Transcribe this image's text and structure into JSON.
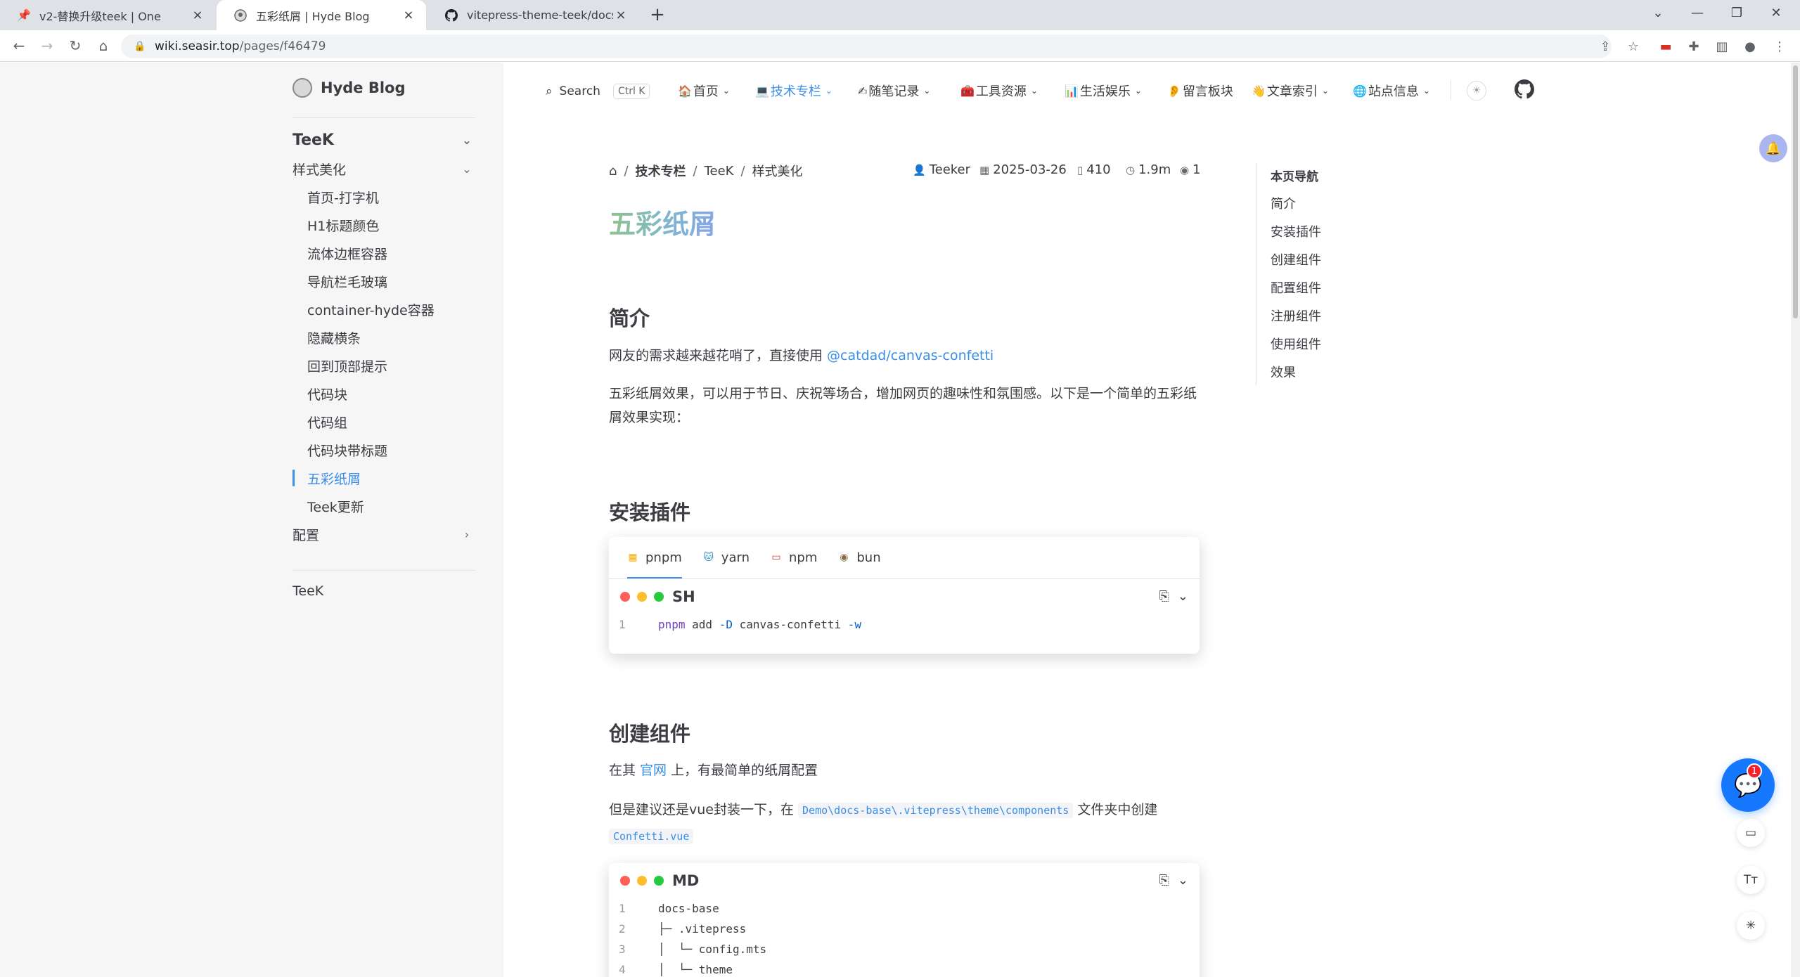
{
  "browser": {
    "tabs": [
      {
        "title": "v2-替换升级teek | One",
        "favicon": "pin-icon"
      },
      {
        "title": "五彩纸屑 | Hyde Blog",
        "favicon": "hyde-icon",
        "active": true
      },
      {
        "title": "vitepress-theme-teek/docs at",
        "favicon": "github-icon"
      }
    ],
    "url_host": "wiki.seasir.top",
    "url_path": "/pages/f46479"
  },
  "sidebar": {
    "brand": "Hyde Blog",
    "group_title": "TeeK",
    "subgroup_title": "样式美化",
    "items": [
      "首页-打字机",
      "H1标题颜色",
      "流体边框容器",
      "导航栏毛玻璃",
      "container-hyde容器",
      "隐藏横条",
      "回到顶部提示",
      "代码块",
      "代码组",
      "代码块带标题",
      "五彩纸屑",
      "Teek更新"
    ],
    "active_item": "五彩纸屑",
    "config_group": "配置",
    "bottom_link": "TeeK"
  },
  "nav": {
    "search_label": "Search",
    "search_kbd": "Ctrl K",
    "items": [
      {
        "label": "首页",
        "icon": "🏠"
      },
      {
        "label": "技术专栏",
        "icon": "💻",
        "active": true
      },
      {
        "label": "随笔记录",
        "icon": "✍"
      },
      {
        "label": "工具资源",
        "icon": "🧰"
      },
      {
        "label": "生活娱乐",
        "icon": "📊"
      },
      {
        "label": "留言板块",
        "icon": "👂"
      },
      {
        "label": "文章索引",
        "icon": "👋"
      },
      {
        "label": "站点信息",
        "icon": "🌐"
      }
    ]
  },
  "doc": {
    "breadcrumb": [
      "技术专栏",
      "TeeK",
      "样式美化"
    ],
    "meta": {
      "author": "Teeker",
      "date": "2025-03-26",
      "words": "410",
      "read_time": "1.9m",
      "views": "1"
    },
    "title": "五彩纸屑",
    "sections": {
      "intro_h": "简介",
      "intro_p1_pre": "网友的需求越来越花哨了，直接使用 ",
      "intro_p1_link": "@catdad/canvas-confetti",
      "intro_p2": "五彩纸屑效果，可以用于节日、庆祝等场合，增加网页的趣味性和氛围感。以下是一个简单的五彩纸屑效果实现：",
      "install_h": "安装插件",
      "create_h": "创建组件",
      "create_p1_pre": "在其 ",
      "create_p1_link": "官网",
      "create_p1_post": " 上，有最简单的纸屑配置",
      "create_p2_pre": "但是建议还是vue封装一下，在 ",
      "create_p2_code1": "Demo\\docs-base\\.vitepress\\theme\\components",
      "create_p2_mid": " 文件夹中创建",
      "create_p2_code2": "Confetti.vue"
    },
    "install_block": {
      "tabs": [
        {
          "label": "pnpm",
          "icon": "▦",
          "active": true
        },
        {
          "label": "yarn",
          "icon": "🐱"
        },
        {
          "label": "npm",
          "icon": "▭"
        },
        {
          "label": "bun",
          "icon": "◉"
        }
      ],
      "lang": "SH",
      "lines": [
        {
          "n": "1",
          "parts": [
            {
              "t": "pnpm",
              "c": "#6f42c1"
            },
            {
              "t": " add ",
              "c": "#3c3c43"
            },
            {
              "t": "-D",
              "c": "#005cc5"
            },
            {
              "t": " canvas-confetti ",
              "c": "#3c3c43"
            },
            {
              "t": "-w",
              "c": "#005cc5"
            }
          ]
        }
      ]
    },
    "tree_block": {
      "lang": "MD",
      "lines": [
        {
          "n": "1",
          "text": "docs-base"
        },
        {
          "n": "2",
          "text": "├─ .vitepress"
        },
        {
          "n": "3",
          "text": "│  └─ config.mts"
        },
        {
          "n": "4",
          "text": "│  └─ theme"
        }
      ]
    }
  },
  "toc": {
    "title": "本页导航",
    "items": [
      "简介",
      "安装插件",
      "创建组件",
      "配置组件",
      "注册组件",
      "使用组件",
      "效果"
    ]
  },
  "floating": {
    "chat_badge": "1"
  },
  "colors": {
    "accent": "#3a8ee6",
    "dot_red": "#ff5f56",
    "dot_yellow": "#ffbd2e",
    "dot_green": "#27c93f",
    "chat_blue": "#1677ff"
  }
}
